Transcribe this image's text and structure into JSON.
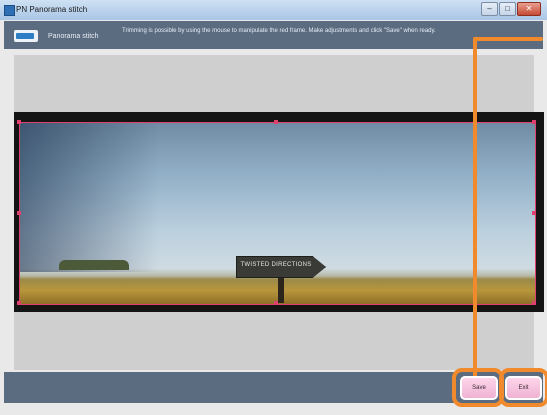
{
  "window": {
    "title": "PN Panorama stitch",
    "controls": {
      "minimize": "–",
      "maximize": "□",
      "close": "✕"
    }
  },
  "header": {
    "app_name": "Panorama stitch",
    "instructions": "Trimming is possible by using the mouse to manipulate the red frame. Make adjustments and click \"Save\" when ready."
  },
  "image": {
    "sign_text": "TWISTED DIRECTIONS"
  },
  "footer": {
    "save_label": "Save",
    "exit_label": "Exit"
  },
  "colors": {
    "header_bg": "#5b6b80",
    "crop_frame": "#e0406e",
    "button_bg": "#f0b2d3",
    "callout": "#f08a2c"
  }
}
